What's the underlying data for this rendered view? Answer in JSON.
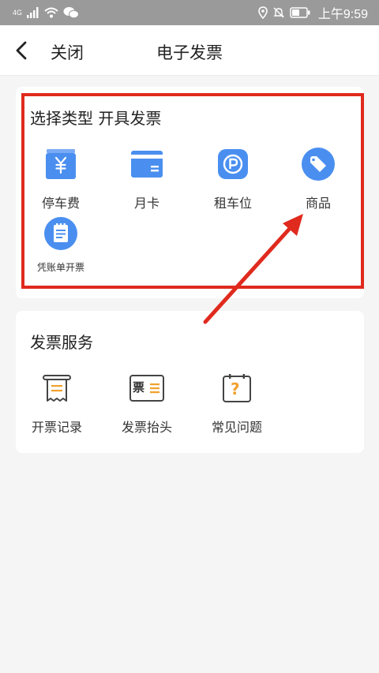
{
  "status_bar": {
    "network": "4G",
    "time": "上午9:59"
  },
  "nav": {
    "close_label": "关闭",
    "title": "电子发票"
  },
  "invoice_types": {
    "title": "选择类型 开具发票",
    "items": [
      {
        "label": "停车费",
        "icon": "yen-receipt-icon"
      },
      {
        "label": "月卡",
        "icon": "card-icon"
      },
      {
        "label": "租车位",
        "icon": "parking-icon"
      },
      {
        "label": "商品",
        "icon": "tag-icon"
      },
      {
        "label": "凭账单开票",
        "icon": "bill-icon"
      }
    ]
  },
  "invoice_services": {
    "title": "发票服务",
    "items": [
      {
        "label": "开票记录",
        "icon": "receipt-record-icon"
      },
      {
        "label": "发票抬头",
        "icon": "invoice-header-icon",
        "icon_text": "票"
      },
      {
        "label": "常见问题",
        "icon": "faq-icon",
        "icon_text": "?"
      }
    ]
  },
  "colors": {
    "accent_blue": "#4a8ff0",
    "highlight_red": "#e02a1e",
    "service_orange": "#f2a12b"
  }
}
